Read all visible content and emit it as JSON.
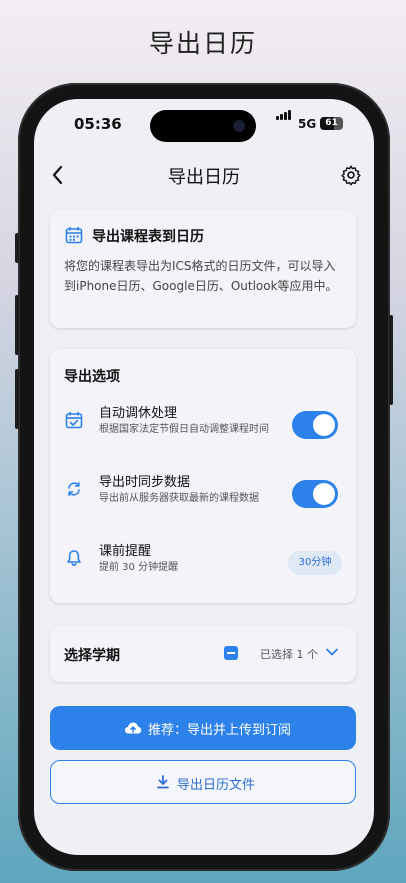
{
  "caption": "导出日历",
  "status_bar": {
    "time": "05:36",
    "network": "5G",
    "battery": "61"
  },
  "battery_level_percent": 61,
  "nav": {
    "title": "导出日历",
    "back_icon": "chevron-left-icon",
    "settings_icon": "gear-icon"
  },
  "info_card": {
    "icon": "calendar-icon",
    "title": "导出课程表到日历",
    "description": "将您的课程表导出为ICS格式的日历文件，可以导入到iPhone日历、Google日历、Outlook等应用中。"
  },
  "options_card": {
    "title": "导出选项",
    "options": [
      {
        "icon": "calendar-check-icon",
        "label": "自动调休处理",
        "desc": "根据国家法定节假日自动调整课程时间",
        "enabled": true
      },
      {
        "icon": "sync-icon",
        "label": "导出时同步数据",
        "desc": "导出前从服务器获取最新的课程数据",
        "enabled": true
      },
      {
        "icon": "bell-icon",
        "label": "课前提醒",
        "desc": "提前 30 分钟提醒",
        "chip": "30分钟"
      }
    ]
  },
  "semester_card": {
    "title": "选择学期",
    "selected_text": "已选择 1 个",
    "chevron_icon": "chevron-down-icon"
  },
  "buttons": {
    "primary_label": "推荐：导出并上传到订阅",
    "primary_icon": "cloud-upload-icon",
    "secondary_label": "导出日历文件",
    "secondary_icon": "download-icon"
  },
  "colors": {
    "accent": "#2c82ea",
    "screen_bg": "#eef0f6",
    "card_bg": "#f3f3f9"
  }
}
